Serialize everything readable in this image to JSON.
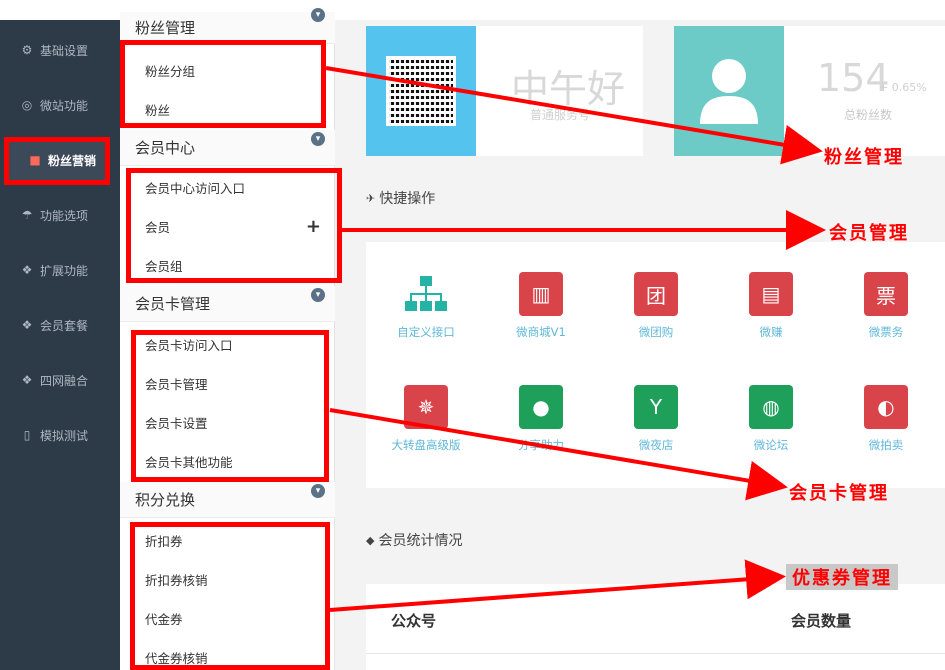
{
  "leftnav": {
    "items": [
      {
        "label": "基础设置",
        "icon": "gear-icon"
      },
      {
        "label": "微站功能",
        "icon": "lifebuoy-icon"
      },
      {
        "label": "粉丝营销",
        "icon": "gift-icon",
        "active": true
      },
      {
        "label": "功能选项",
        "icon": "umbrella-icon"
      },
      {
        "label": "扩展功能",
        "icon": "cubes-icon"
      },
      {
        "label": "会员套餐",
        "icon": "cubes-icon"
      },
      {
        "label": "四网融合",
        "icon": "cubes-icon"
      },
      {
        "label": "模拟测试",
        "icon": "mobile-icon"
      }
    ]
  },
  "submenu": {
    "fans": {
      "title": "粉丝管理",
      "items": [
        "粉丝分组",
        "粉丝"
      ]
    },
    "member_center": {
      "title": "会员中心",
      "items": [
        "会员中心访问入口",
        "会员",
        "会员组"
      ]
    },
    "member_card": {
      "title": "会员卡管理",
      "items": [
        "会员卡访问入口",
        "会员卡管理",
        "会员卡设置",
        "会员卡其他功能"
      ]
    },
    "points": {
      "title": "积分兑换",
      "items": [
        "折扣券",
        "折扣券核销",
        "代金券",
        "代金券核销"
      ]
    }
  },
  "dashboard": {
    "greeting": "中午好",
    "greeting_sub": "普通服务号",
    "fan_count": "154",
    "fan_change": "+ 0.65%",
    "fan_label": "总粉丝数"
  },
  "quick_ops": {
    "title": "快捷操作",
    "items": [
      {
        "label": "自定义接口",
        "icon": "sitemap-icon",
        "color": "#25b3a6"
      },
      {
        "label": "微商城V1",
        "icon": "building-icon",
        "color": "#d9434a"
      },
      {
        "label": "微团购",
        "icon": "tuan-icon",
        "color": "#d9434a"
      },
      {
        "label": "微赚",
        "icon": "clipboard-icon",
        "color": "#d9434a"
      },
      {
        "label": "微票务",
        "icon": "ticket-icon",
        "color": "#d9434a"
      },
      {
        "label": "大转盘高级版",
        "icon": "wheel-icon",
        "color": "#d9434a"
      },
      {
        "label": "分享助力",
        "icon": "chat-icon",
        "color": "#1fa05a"
      },
      {
        "label": "微夜店",
        "icon": "cocktail-icon",
        "color": "#1fa05a"
      },
      {
        "label": "微论坛",
        "icon": "globe-chat-icon",
        "color": "#1fa05a"
      },
      {
        "label": "微拍卖",
        "icon": "mouse-icon",
        "color": "#d9434a"
      }
    ]
  },
  "member_stats": {
    "title": "会员统计情况",
    "columns": [
      "公众号",
      "会员数量"
    ]
  },
  "annotations": {
    "fans": "粉丝管理",
    "member": "会员管理",
    "card": "会员卡管理",
    "coupon": "优惠券管理"
  }
}
